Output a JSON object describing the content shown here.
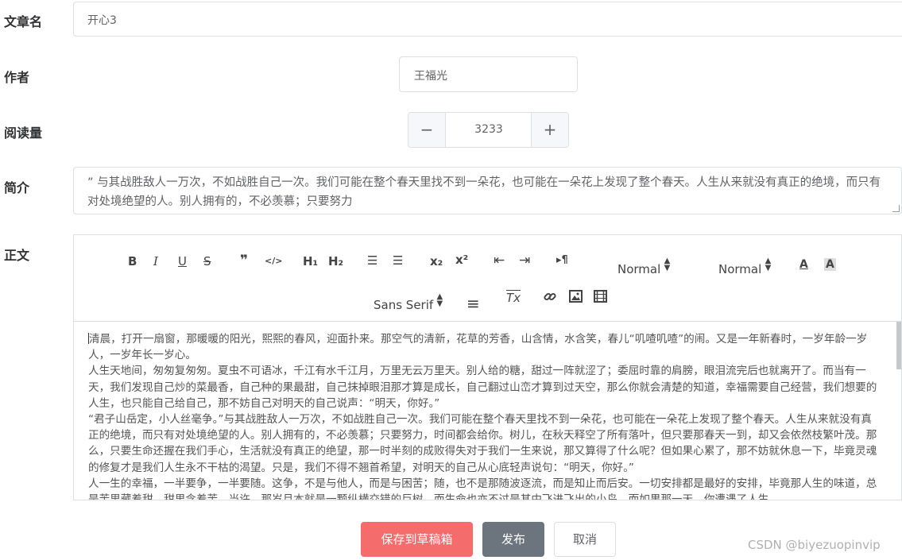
{
  "form": {
    "title_label": "文章名",
    "title_value": "开心3",
    "author_label": "作者",
    "author_value": "王福光",
    "views_label": "阅读量",
    "views_minus": "−",
    "views_value": "3233",
    "views_plus": "+",
    "summary_label": "简介",
    "summary_value": "” 与其战胜敌人一万次，不如战胜自己一次。我们可能在整个春天里找不到一朵花，也可能在一朵花上发现了整个春天。人生从来就没有真正的绝境，而只有对处境绝望的人。别人拥有的，不必羡慕；只要努力",
    "body_label": "正文"
  },
  "toolbar": {
    "bold": "B",
    "italic": "I",
    "underline": "U",
    "strike": "S",
    "blockquote": "❞",
    "code": "</>",
    "h1": "H₁",
    "h2": "H₂",
    "ordered_list": "☰",
    "bullet_list": "☰",
    "subscript": "x₂",
    "superscript": "x²",
    "outdent": "⇤",
    "indent": "⇥",
    "direction": "▸¶",
    "size_picker": "Normal",
    "header_picker": "Normal",
    "color": "A",
    "background": "A",
    "font_picker": "Sans Serif",
    "align": "≡",
    "clean": "Tx",
    "link": "🔗",
    "image": "▣",
    "video": "▦"
  },
  "editor": {
    "p1": "清晨，打开一扇窗，那暖暖的阳光，熙熙的春风，迎面扑来。那空气的清新，花草的芳香，山含情，水含笑，春儿“叽喳叽喳”的闹。又是一年新春时，一岁年龄一岁人，一岁年长一岁心。",
    "p2": "人生天地间，匆匆复匆匆。夏虫不可语冰，千江有水千江月，万里无云万里天。别人给的糖，甜过一阵就涩了；委屈时靠的肩膀，眼泪流完后也就离开了。而当有一天，我们发现自己炒的菜最香，自己种的果最甜，自己抹掉眼泪那才算是成长，自己翻过山峦才算到过天空，那么你就会清楚的知道，幸福需要自己经营，我们想要的人生，也只能自己给自己，那不妨自己对明天的自己说声：“明天，你好。”",
    "p3": "“君子山岳定，小人丝毫争。”与其战胜敌人一万次，不如战胜自己一次。我们可能在整个春天里找不到一朵花，也可能在一朵花上发现了整个春天。人生从来就没有真正的绝境，而只有对处境绝望的人。别人拥有的，不必羡慕；只要努力，时间都会给你。树儿，在秋天释空了所有落叶，但只要那春天一到，却又会依然枝繁叶茂。那么，只要生命还握在我们手心，生活就没有真正的绝望，那一时半刻的成败得失对于我们一生来说，那又算得了什么呢？但如果心累了，那不妨就休息一下，毕竟灵魂的修复才是我们人生永不干枯的渴望。只是，我们不得不翘首希望，对明天的自己从心底轻声说句：“明天，你好。”",
    "p4": "人一生的幸福，一半要争，一半要随。这争，不是与他人，而是与困苦；随，也不是那随波逐流，而是知止而后安。一切安排都是最好的安排，毕竟那人生的味道，总是苦里藏着甜，甜里含着苦。当许，那岁月本就是一颗纵横交错的巨树，而生命也亦不过是其中飞进飞出的小鸟。而如果那一天，你遭遇了人生"
  },
  "actions": {
    "draft": "保存到草稿箱",
    "publish": "发布",
    "cancel": "取消"
  },
  "watermark": "CSDN @biyezuopinvip",
  "colors": {
    "draft_button": "#f56c6c",
    "publish_button": "#6c757d",
    "border": "#dcdfe6"
  }
}
